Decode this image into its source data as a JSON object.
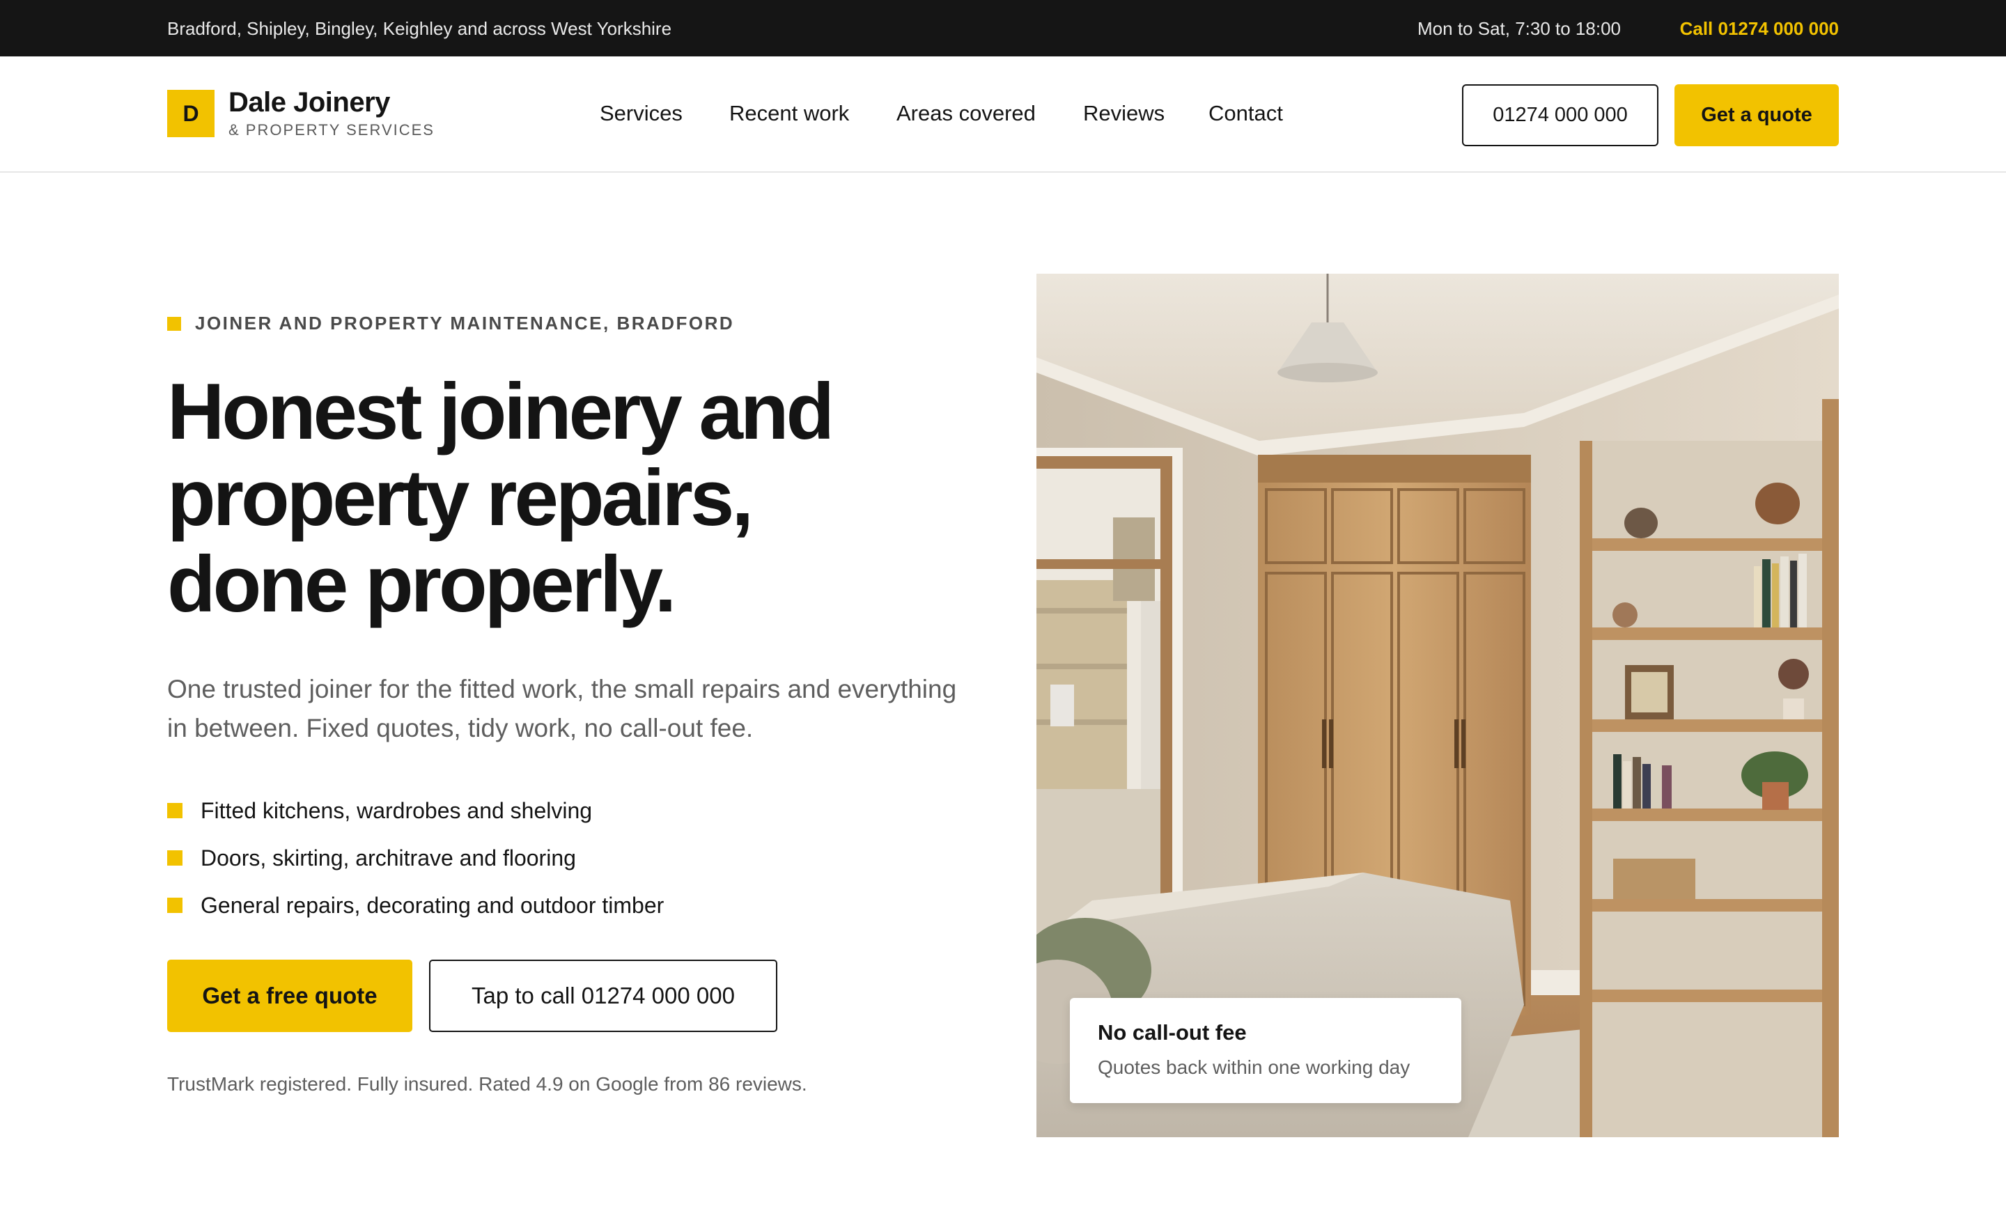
{
  "topbar": {
    "service_area": "Bradford, Shipley, Bingley, Keighley and across West Yorkshire",
    "hours": "Mon to Sat, 7:30 to 18:00",
    "call": "Call 01274 000 000"
  },
  "header": {
    "logo_letter": "D",
    "brand_name": "Dale Joinery",
    "brand_sub": "& PROPERTY SERVICES",
    "nav": [
      "Services",
      "Recent work",
      "Areas covered",
      "Reviews",
      "Contact"
    ],
    "phone_button": "01274 000 000",
    "quote_button": "Get a quote"
  },
  "hero": {
    "eyebrow": "JOINER AND PROPERTY MAINTENANCE, BRADFORD",
    "headline_lines": [
      "Honest joinery and",
      "property repairs,",
      "done properly."
    ],
    "lede": "One trusted joiner for the fitted work, the small repairs and everything in between. Fixed quotes, tidy work, no call-out fee.",
    "bullets": [
      "Fitted kitchens, wardrobes and shelving",
      "Doors, skirting, architrave and flooring",
      "General repairs, decorating and outdoor timber"
    ],
    "cta_primary": "Get a free quote",
    "cta_secondary": "Tap to call 01274 000 000",
    "trust_line": "TrustMark registered. Fully insured. Rated 4.9 on Google from 86 reviews."
  },
  "image_card": {
    "title": "No call-out fee",
    "subtitle": "Quotes back within one working day"
  },
  "colors": {
    "accent": "#f2c200",
    "topbar_bg": "#151515",
    "text": "#141414",
    "muted": "#5e5e5e"
  },
  "icons": {
    "bullet_marker": "yellow-square-icon",
    "eyebrow_marker": "yellow-square-icon"
  }
}
